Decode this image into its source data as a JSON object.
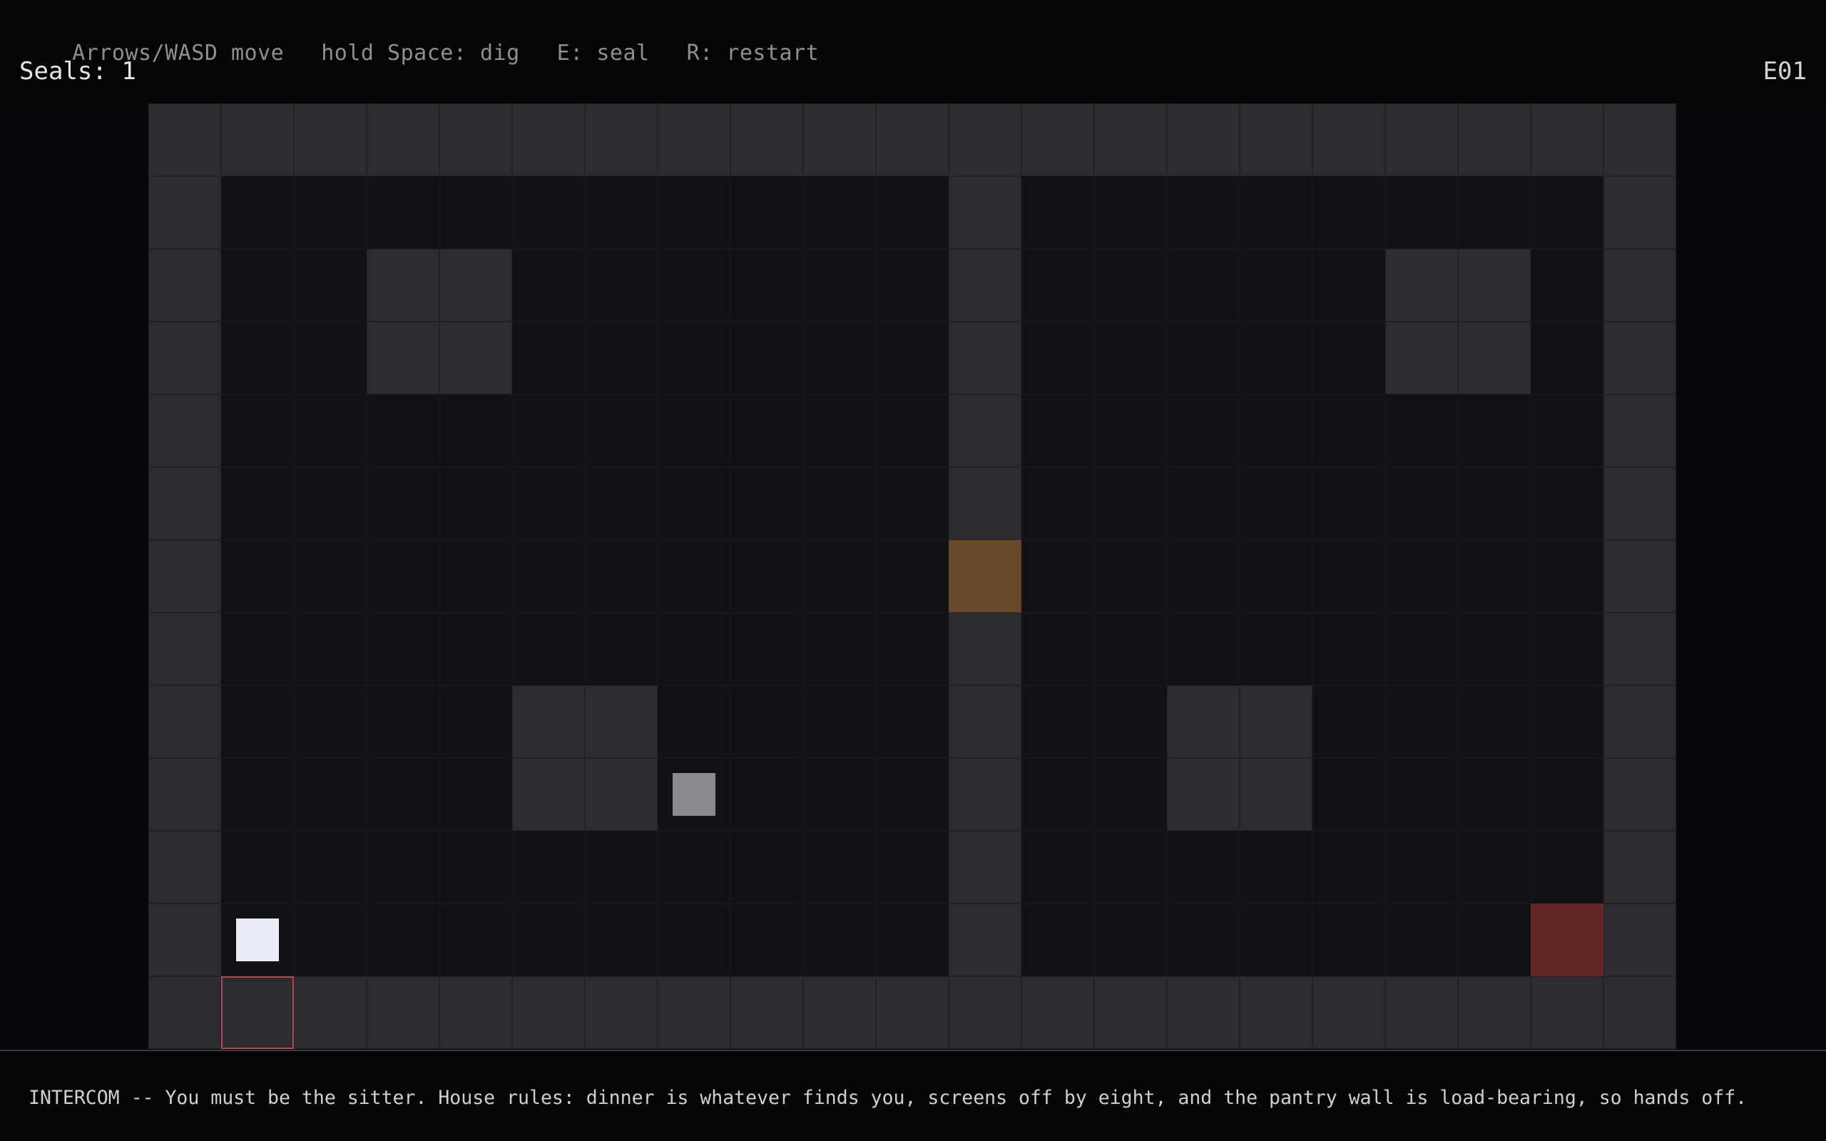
{
  "hud": {
    "controls": [
      "Arrows/WASD move",
      "hold Space: dig",
      "E: seal",
      "R: restart"
    ],
    "seals_label": "Seals:",
    "seals_count": "1",
    "level_code": "E01"
  },
  "dialog": {
    "text": "INTERCOM -- You must be the sitter. House rules: dinner is whatever finds you, screens off by eight, and the pantry wall is load-bearing, so hands off."
  },
  "colors": {
    "wall": "#2c2c31",
    "floor": "#121215",
    "door": "#674a2a",
    "exit": "#622725",
    "player": "#ececf6",
    "item": "#8a8a8e",
    "selection": "#b34a46"
  },
  "map": {
    "legend": {
      "#": "wall",
      ".": "floor",
      "D": "door",
      "X": "exit",
      "S": "selected-wall"
    },
    "rows": [
      "#####################",
      "#..........#........#",
      "#..##......#.....##.#",
      "#..##......#.....##.#",
      "#..........#........#",
      "#..........#........#",
      "#..........D........#",
      "#..........#........#",
      "#....##....#..##....#",
      "#....##....#..##....#",
      "#..........#........#",
      "#..........#.......X#",
      "#S###################"
    ],
    "player": {
      "col": 1,
      "row": 11
    },
    "item": {
      "col": 7,
      "row": 9
    }
  }
}
